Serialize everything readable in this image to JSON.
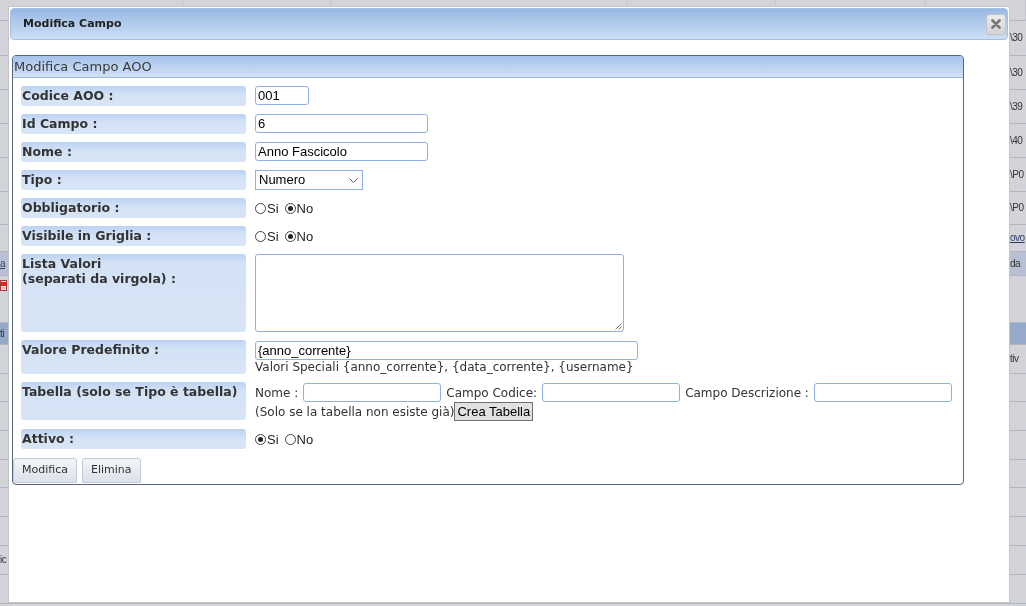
{
  "background": {
    "left_edge": [
      {
        "kind": "link",
        "text": "a"
      },
      {
        "kind": "icon"
      },
      {
        "kind": "text",
        "text": "ti"
      },
      {
        "kind": "text",
        "text": "ic"
      }
    ],
    "right_edge": [
      {
        "kind": "text",
        "text": "\\30"
      },
      {
        "kind": "text",
        "text": "\\30"
      },
      {
        "kind": "text",
        "text": "\\39"
      },
      {
        "kind": "text",
        "text": "\\40"
      },
      {
        "kind": "text",
        "text": "\\P0"
      },
      {
        "kind": "text",
        "text": "\\P0"
      },
      {
        "kind": "link",
        "text": "ovo"
      },
      {
        "kind": "text",
        "text": "da"
      },
      {
        "kind": "text",
        "text": "tiv"
      }
    ]
  },
  "dialog": {
    "title": "Modifica Campo"
  },
  "panel": {
    "title": "Modifica Campo AOO",
    "rows": [
      {
        "kind": "short",
        "label": "Codice AOO :",
        "value": "001"
      },
      {
        "kind": "text",
        "label": "Id Campo :",
        "value": "6"
      },
      {
        "kind": "text",
        "label": "Nome :",
        "value": "Anno Fascicolo"
      },
      {
        "kind": "select",
        "label": "Tipo :",
        "value": "Numero"
      },
      {
        "kind": "radio",
        "label": "Obbligatorio :",
        "options": [
          {
            "label": "Si",
            "selected": false
          },
          {
            "label": "No",
            "selected": true
          }
        ]
      },
      {
        "kind": "radio",
        "label": "Visibile in Griglia :",
        "options": [
          {
            "label": "Si",
            "selected": false
          },
          {
            "label": "No",
            "selected": true
          }
        ]
      },
      {
        "kind": "textarea",
        "label": "Lista Valori\n(separati da virgola) :"
      },
      {
        "kind": "wide",
        "label": "Valore Predefinito :",
        "value": "{anno_corrente}",
        "hint": "Valori Speciali {anno_corrente}, {data_corrente}, {username}"
      },
      {
        "kind": "table",
        "label": "Tabella (solo se Tipo è tabella)",
        "fields": [
          {
            "label": "Nome :"
          },
          {
            "label": "Campo Codice:"
          },
          {
            "label": "Campo Descrizione :"
          }
        ],
        "note": "(Solo se la tabella non esiste già)",
        "button": "Crea Tabella"
      },
      {
        "kind": "radio",
        "label": "Attivo :",
        "options": [
          {
            "label": "Si",
            "selected": true
          },
          {
            "label": "No",
            "selected": false
          }
        ]
      }
    ],
    "buttons": [
      "Modifica",
      "Elimina"
    ]
  }
}
